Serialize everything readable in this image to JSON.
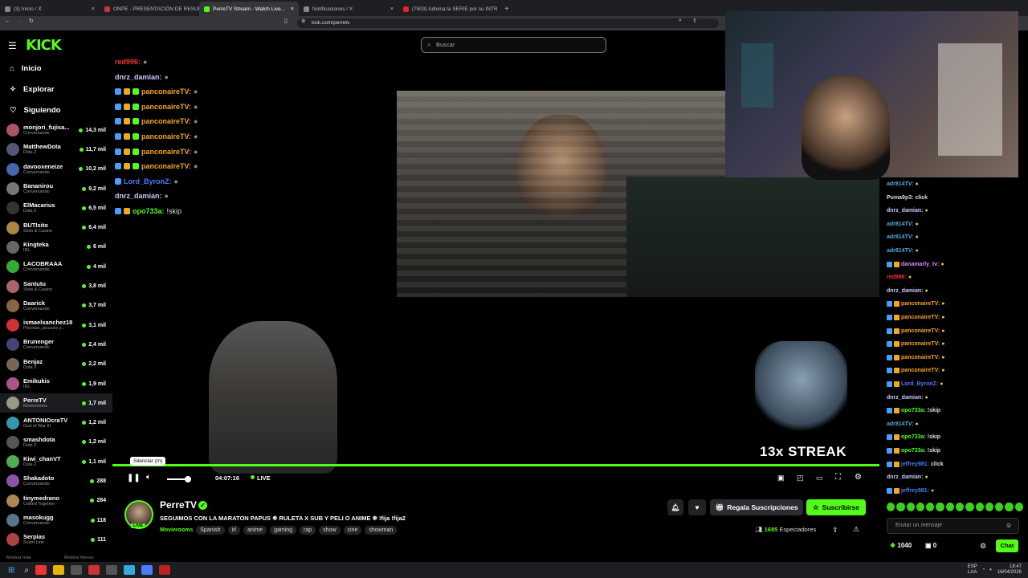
{
  "browser": {
    "tabs": [
      {
        "label": "(3) Inicio / X",
        "color": "#888"
      },
      {
        "label": "ONPE - PRESENTACIÓN DE RESULTA...",
        "color": "#c33"
      },
      {
        "label": "PerreTV Stream - Watch Live...",
        "color": "#53fc18",
        "active": true
      },
      {
        "label": "Notificaciones / X",
        "color": "#888"
      },
      {
        "label": "(7803) Adivina la SERIE por su INTRO...",
        "color": "#e22"
      }
    ],
    "url": "kick.com/perretv"
  },
  "kick": {
    "logo": "KICK",
    "search_placeholder": "Buscar"
  },
  "sidebar": {
    "nav": [
      {
        "label": "Inicio",
        "icon": "home-icon"
      },
      {
        "label": "Explorar",
        "icon": "compass-icon"
      },
      {
        "label": "Siguiendo",
        "icon": "heart-icon"
      }
    ],
    "channels": [
      {
        "name": "monjori_fujisa...",
        "category": "Conversando",
        "viewers": "14,3 mil",
        "color": "#a56"
      },
      {
        "name": "MatthewDota",
        "category": "Dota 2",
        "viewers": "11,7 mil",
        "color": "#557"
      },
      {
        "name": "davooxeneize",
        "category": "Conversando",
        "viewers": "10,2 mil",
        "color": "#46a"
      },
      {
        "name": "Bananirou",
        "category": "Conversando",
        "viewers": "9,2 mil",
        "color": "#777"
      },
      {
        "name": "ElMacarius",
        "category": "Dota 2",
        "viewers": "6,5 mil",
        "color": "#333"
      },
      {
        "name": "BUTIsito",
        "category": "Slots & Casino",
        "viewers": "6,4 mil",
        "color": "#a84"
      },
      {
        "name": "Kingteka",
        "category": "IRL",
        "viewers": "6 mil",
        "color": "#666"
      },
      {
        "name": "LACOBRAAA",
        "category": "Conversando",
        "viewers": "4 mil",
        "color": "#3a3"
      },
      {
        "name": "Santutu",
        "category": "Slots & Casino",
        "viewers": "3,8 mil",
        "color": "#a66"
      },
      {
        "name": "Daarick",
        "category": "Conversando",
        "viewers": "3,7 mil",
        "color": "#864"
      },
      {
        "name": "ismaelsanchez18",
        "category": "Piscinas, jacuzzis y...",
        "viewers": "3,1 mil",
        "color": "#c33"
      },
      {
        "name": "Brunenger",
        "category": "Conversando",
        "viewers": "2,4 mil",
        "color": "#447"
      },
      {
        "name": "Benjaz",
        "category": "Dota 2",
        "viewers": "2,2 mil",
        "color": "#765"
      },
      {
        "name": "Emikukis",
        "category": "IRL",
        "viewers": "1,9 mil",
        "color": "#a58"
      },
      {
        "name": "PerreTV",
        "category": "Movierooms",
        "viewers": "1,7 mil",
        "color": "#998",
        "selected": true
      },
      {
        "name": "ANTONIOcraTV",
        "category": "God of War III",
        "viewers": "1,2 mil",
        "color": "#39a"
      },
      {
        "name": "smashdota",
        "category": "Dota 2",
        "viewers": "1,2 mil",
        "color": "#555"
      },
      {
        "name": "Kiwi_chanVT",
        "category": "Dota 2",
        "viewers": "1,1 mil",
        "color": "#5a5"
      },
      {
        "name": "Shakadoto",
        "category": "Conversando",
        "viewers": "288",
        "color": "#85a"
      },
      {
        "name": "tinymedrano",
        "category": "Chilled Together",
        "viewers": "284",
        "color": "#a85"
      },
      {
        "name": "masokugg",
        "category": "Conversando",
        "viewers": "118",
        "color": "#578"
      },
      {
        "name": "Serpias",
        "category": "Scam Line",
        "viewers": "111",
        "color": "#a44"
      }
    ],
    "footer_left": "Mostrar más",
    "footer_right": "Mostrar Menos"
  },
  "video_overlay_chat": [
    {
      "user": "red996:",
      "color": "#e33",
      "badges": 0
    },
    {
      "user": "dnrz_damian:",
      "color": "#c9c9ff",
      "badges": 0
    },
    {
      "user": "panconaireTV:",
      "color": "#f5a623",
      "badges": 3
    },
    {
      "user": "panconaireTV:",
      "color": "#f5a623",
      "badges": 3
    },
    {
      "user": "panconaireTV:",
      "color": "#f5a623",
      "badges": 3
    },
    {
      "user": "panconaireTV:",
      "color": "#f5a623",
      "badges": 3
    },
    {
      "user": "panconaireTV:",
      "color": "#f5a623",
      "badges": 3
    },
    {
      "user": "panconaireTV:",
      "color": "#f5a623",
      "badges": 3
    },
    {
      "user": "Lord_ByronZ:",
      "color": "#4a7cff",
      "badges": 1
    },
    {
      "user": "dnrz_damian:",
      "color": "#c9c9ff",
      "badges": 0
    },
    {
      "user": "opo733a:",
      "color": "#53fc18",
      "badges": 2,
      "msg": "!skip"
    }
  ],
  "streak_text": "13x STREAK",
  "player": {
    "tooltip": "Silenciar (m)",
    "time": "04:07:16",
    "live": "LIVE",
    "volume_fraction": 0.6
  },
  "channel": {
    "name": "PerreTV",
    "live_badge": "LIVE",
    "title": "SEGUIMOS CON LA MARATON PAPUS ❄ RULETA X SUB Y PELI O ANIME ❄ !fija !fija2",
    "category": "Movierooms",
    "tags": [
      "Spanish",
      "irl",
      "anime",
      "gaming",
      "rap",
      "show",
      "cine",
      "showman"
    ],
    "gift_label": "Regala Suscripciones",
    "subscribe_label": "Suscribirse",
    "viewers": "1685",
    "viewers_label": "Espectadores"
  },
  "right_chat": [
    {
      "user": "adr814TV:",
      "color": "#5ad",
      "msg": ""
    },
    {
      "user": "Puma9p3:",
      "color": "#ddd",
      "msg": "click"
    },
    {
      "user": "dnrz_damian:",
      "color": "#c9c9ff",
      "msg": ""
    },
    {
      "user": "adr814TV:",
      "color": "#5ad",
      "msg": ""
    },
    {
      "user": "adr814TV:",
      "color": "#5ad",
      "msg": ""
    },
    {
      "user": "adr814TV:",
      "color": "#5ad",
      "msg": ""
    },
    {
      "user": "danamarly_tv:",
      "color": "#d98cff",
      "msg": ""
    },
    {
      "user": "red996:",
      "color": "#e33",
      "msg": ""
    },
    {
      "user": "dnrz_damian:",
      "color": "#c9c9ff",
      "msg": ""
    },
    {
      "user": "panconaireTV:",
      "color": "#f5a623",
      "msg": ""
    },
    {
      "user": "panconaireTV:",
      "color": "#f5a623",
      "msg": ""
    },
    {
      "user": "panconaireTV:",
      "color": "#f5a623",
      "msg": ""
    },
    {
      "user": "panconaireTV:",
      "color": "#f5a623",
      "msg": ""
    },
    {
      "user": "panconaireTV:",
      "color": "#f5a623",
      "msg": ""
    },
    {
      "user": "panconaireTV:",
      "color": "#f5a623",
      "msg": ""
    },
    {
      "user": "Lord_ByronZ:",
      "color": "#4a7cff",
      "msg": ""
    },
    {
      "user": "dnrz_damian:",
      "color": "#c9c9ff",
      "msg": ""
    },
    {
      "user": "opo733a:",
      "color": "#53fc18",
      "msg": "!skip"
    },
    {
      "user": "adr814TV:",
      "color": "#5ad",
      "msg": ""
    },
    {
      "user": "opo733a:",
      "color": "#53fc18",
      "msg": "!skip"
    },
    {
      "user": "opo733a:",
      "color": "#53fc18",
      "msg": "!skip"
    },
    {
      "user": "jeffrey981:",
      "color": "#4a7cff",
      "msg": "click"
    },
    {
      "user": "dnrz_damian:",
      "color": "#c9c9ff",
      "msg": ""
    },
    {
      "user": "jeffrey981:",
      "color": "#4a7cff",
      "msg": ""
    }
  ],
  "chat_input_placeholder": "Enviar un mensaje",
  "chat_points": "1040",
  "chat_count": "0",
  "chat_button": "Chat",
  "taskbar": {
    "lang": "ESP",
    "lang2": "LAA",
    "time": "18:47",
    "date": "16/04/2026"
  },
  "colors": {
    "accent": "#53fc18"
  }
}
